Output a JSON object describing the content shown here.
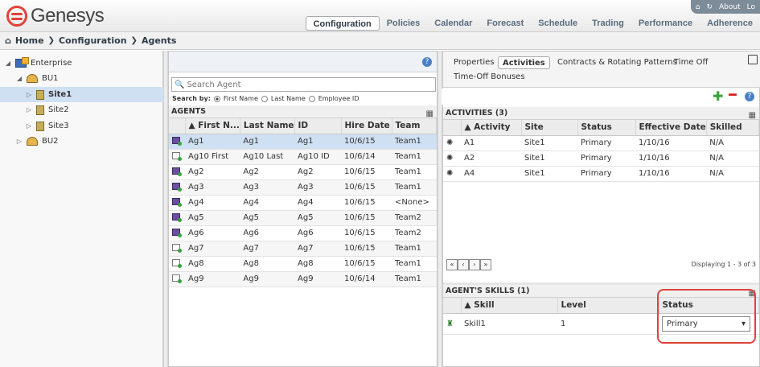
{
  "app": {
    "brand": "Genesys"
  },
  "util": {
    "about": "About",
    "logout": "Lo"
  },
  "nav": [
    "Configuration",
    "Policies",
    "Calendar",
    "Forecast",
    "Schedule",
    "Trading",
    "Performance",
    "Adherence"
  ],
  "breadcrumb": [
    "Home",
    "Configuration",
    "Agents"
  ],
  "tree": [
    {
      "label": "Enterprise"
    },
    {
      "label": "BU1"
    },
    {
      "label": "Site1"
    },
    {
      "label": "Site2"
    },
    {
      "label": "Site3"
    },
    {
      "label": "BU2"
    }
  ],
  "search": {
    "placeholder": "Search Agent",
    "by_label": "Search by:",
    "options": [
      "First Name",
      "Last Name",
      "Employee ID"
    ]
  },
  "agents": {
    "header": "AGENTS",
    "columns": [
      "First N...",
      "Last Name",
      "ID",
      "Hire Date",
      "Team"
    ],
    "rows": [
      [
        "Ag1",
        "Ag1",
        "Ag1",
        "10/6/15",
        "Team1"
      ],
      [
        "Ag10 First",
        "Ag10 Last",
        "Ag10 ID",
        "10/6/14",
        "Team1"
      ],
      [
        "Ag2",
        "Ag2",
        "Ag2",
        "10/6/15",
        "Team1"
      ],
      [
        "Ag3",
        "Ag3",
        "Ag3",
        "10/6/15",
        "Team1"
      ],
      [
        "Ag4",
        "Ag4",
        "Ag4",
        "10/6/15",
        "<None>"
      ],
      [
        "Ag5",
        "Ag5",
        "Ag5",
        "10/6/15",
        "Team2"
      ],
      [
        "Ag6",
        "Ag6",
        "Ag6",
        "10/6/15",
        "Team2"
      ],
      [
        "Ag7",
        "Ag7",
        "Ag7",
        "10/6/15",
        "Team1"
      ],
      [
        "Ag8",
        "Ag8",
        "Ag8",
        "10/6/15",
        "Team1"
      ],
      [
        "Ag9",
        "Ag9",
        "Ag9",
        "10/6/14",
        "Team1"
      ]
    ]
  },
  "tabs": [
    "Properties",
    "Activities",
    "Contracts & Rotating Patterns",
    "Time Off",
    "Time-Off Bonuses"
  ],
  "activities": {
    "header": "ACTIVITIES (3)",
    "columns": [
      "Activity",
      "Site",
      "Status",
      "Effective Date",
      "Skilled"
    ],
    "rows": [
      [
        "A1",
        "Site1",
        "Primary",
        "1/10/16",
        "N/A"
      ],
      [
        "A2",
        "Site1",
        "Primary",
        "1/10/16",
        "N/A"
      ],
      [
        "A4",
        "Site1",
        "Primary",
        "1/10/16",
        "N/A"
      ]
    ],
    "pager_text": "Displaying 1 - 3 of 3"
  },
  "skills": {
    "header": "AGENT'S SKILLS (1)",
    "columns": [
      "Skill",
      "Level",
      "Status"
    ],
    "rows": [
      {
        "skill": "Skill1",
        "level": "1",
        "status": "Primary"
      }
    ]
  }
}
